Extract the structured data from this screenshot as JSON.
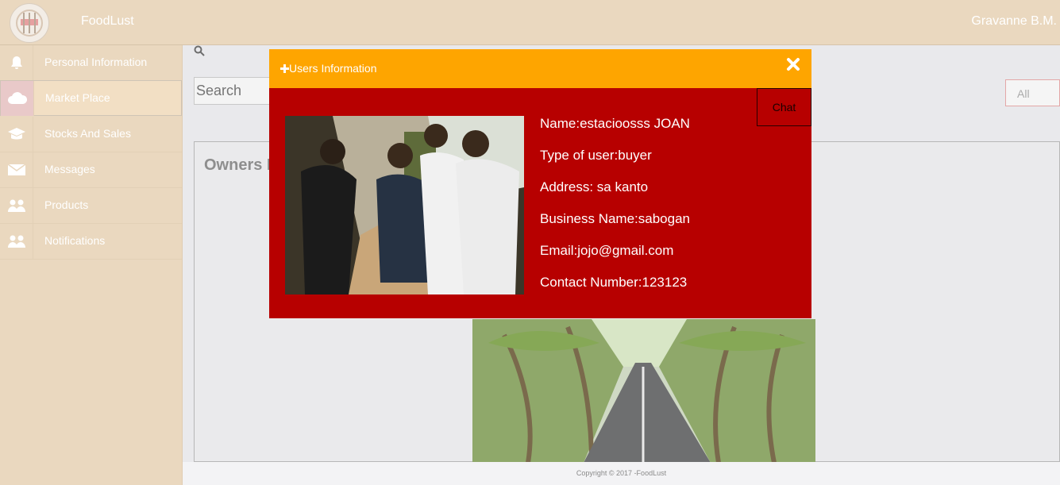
{
  "header": {
    "brand": "FoodLust",
    "user_name": "Gravanne B.M."
  },
  "sidebar": {
    "items": [
      {
        "label": "Personal Information",
        "icon": "bell-icon"
      },
      {
        "label": "Market Place",
        "icon": "cloud-icon"
      },
      {
        "label": "Stocks And Sales",
        "icon": "graduation-cap-icon"
      },
      {
        "label": "Messages",
        "icon": "envelope-icon"
      },
      {
        "label": "Products",
        "icon": "group-icon"
      },
      {
        "label": "Notifications",
        "icon": "group-icon"
      }
    ]
  },
  "main": {
    "search_placeholder": "Search",
    "filter_value": "All",
    "owners_title": "Owners I"
  },
  "modal": {
    "title": "Users Information",
    "chat_label": "Chat",
    "fields": [
      "Name:estacioosss JOAN",
      "Type of user:buyer",
      "Address: sa kanto",
      "Business Name:sabogan",
      "Email:jojo@gmail.com",
      "Contact Number:123123"
    ]
  },
  "footer": {
    "copyright": "Copyright © 2017 -FoodLust"
  },
  "colors": {
    "modal_header": "#fea500",
    "modal_body": "#b70000",
    "sidebar": "#ead8bf"
  }
}
